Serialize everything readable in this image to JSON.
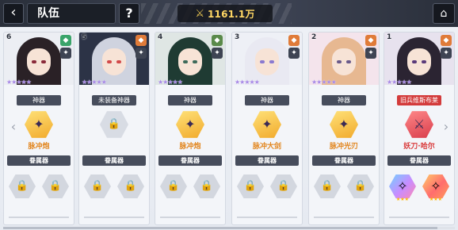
{
  "header": {
    "back_icon": "back-arrow-icon",
    "title": "队伍",
    "help_label": "?",
    "power_icon": "crossed-swords-icon",
    "power_value": "1161.1万",
    "home_icon": "home-icon"
  },
  "slots": [
    {
      "pos": "1",
      "stars": "★★★★★",
      "weapon_label": "旧兵维斯布莱",
      "weapon_label_red": true,
      "weapon_state": "red",
      "weapon_glyph": "⚔",
      "weapon_name": "妖刀·哈尔",
      "section_label": "眷属器",
      "attached": [
        {
          "state": "lit1",
          "glyph": "✧",
          "stars": "★★★"
        },
        {
          "state": "lit2",
          "glyph": "✧",
          "stars": "★★★"
        }
      ],
      "colors": {
        "bg": "#e7e2ee",
        "hair": "#2b2432",
        "eye": "#5a3a7a",
        "badge": "#e07b39"
      }
    },
    {
      "pos": "2",
      "stars": "★★★★★",
      "weapon_label": "神器",
      "weapon_label_red": false,
      "weapon_state": "gold",
      "weapon_glyph": "✦",
      "weapon_name": "脉冲光刃",
      "section_label": "眷属器",
      "attached": [
        {
          "state": "locked",
          "glyph": "🔒",
          "stars": ""
        },
        {
          "state": "locked",
          "glyph": "🔒",
          "stars": ""
        }
      ],
      "colors": {
        "bg": "#f4e4ec",
        "hair": "#e7b891",
        "eye": "#6a5a8a",
        "badge": "#e07b39"
      }
    },
    {
      "pos": "3",
      "stars": "★★★★★",
      "weapon_label": "神器",
      "weapon_label_red": false,
      "weapon_state": "gold",
      "weapon_glyph": "✦",
      "weapon_name": "脉冲大剑",
      "section_label": "眷属器",
      "attached": [
        {
          "state": "locked",
          "glyph": "🔒",
          "stars": ""
        },
        {
          "state": "locked",
          "glyph": "🔒",
          "stars": ""
        }
      ],
      "colors": {
        "bg": "#eef0f6",
        "hair": "#e9e9f2",
        "eye": "#8a7ad0",
        "badge": "#e07b39"
      }
    },
    {
      "pos": "4",
      "stars": "★★★★★",
      "weapon_label": "神器",
      "weapon_label_red": false,
      "weapon_state": "gold",
      "weapon_glyph": "✦",
      "weapon_name": "脉冲炮",
      "section_label": "眷属器",
      "attached": [
        {
          "state": "locked",
          "glyph": "🔒",
          "stars": ""
        },
        {
          "state": "locked",
          "glyph": "🔒",
          "stars": ""
        }
      ],
      "colors": {
        "bg": "#dfe6e4",
        "hair": "#1f3b33",
        "eye": "#3d6a5a",
        "badge": "#5a8a4a"
      }
    },
    {
      "pos": "5",
      "stars": "★★★★★",
      "weapon_label": "未装备神器",
      "weapon_label_red": false,
      "weapon_state": "empty",
      "weapon_glyph": "🔒",
      "weapon_name": "",
      "section_label": "眷属器",
      "attached": [
        {
          "state": "locked",
          "glyph": "🔒",
          "stars": ""
        },
        {
          "state": "locked",
          "glyph": "🔒",
          "stars": ""
        }
      ],
      "colors": {
        "bg": "#2c3346",
        "hair": "#cfd3df",
        "eye": "#d24a4a",
        "badge": "#e07b39"
      }
    },
    {
      "pos": "6",
      "stars": "★★★★★",
      "weapon_label": "神器",
      "weapon_label_red": false,
      "weapon_state": "gold",
      "weapon_glyph": "✦",
      "weapon_name": "脉冲炮",
      "section_label": "眷属器",
      "attached": [
        {
          "state": "locked",
          "glyph": "🔒",
          "stars": ""
        },
        {
          "state": "locked",
          "glyph": "🔒",
          "stars": ""
        }
      ],
      "colors": {
        "bg": "#eceef3",
        "hair": "#2a2126",
        "eye": "#8a2a3a",
        "badge": "#3aa46a"
      }
    }
  ],
  "nav": {
    "prev_icon": "chevron-left-icon",
    "next_icon": "chevron-right-icon",
    "prev_glyph": "‹",
    "next_glyph": "›"
  }
}
